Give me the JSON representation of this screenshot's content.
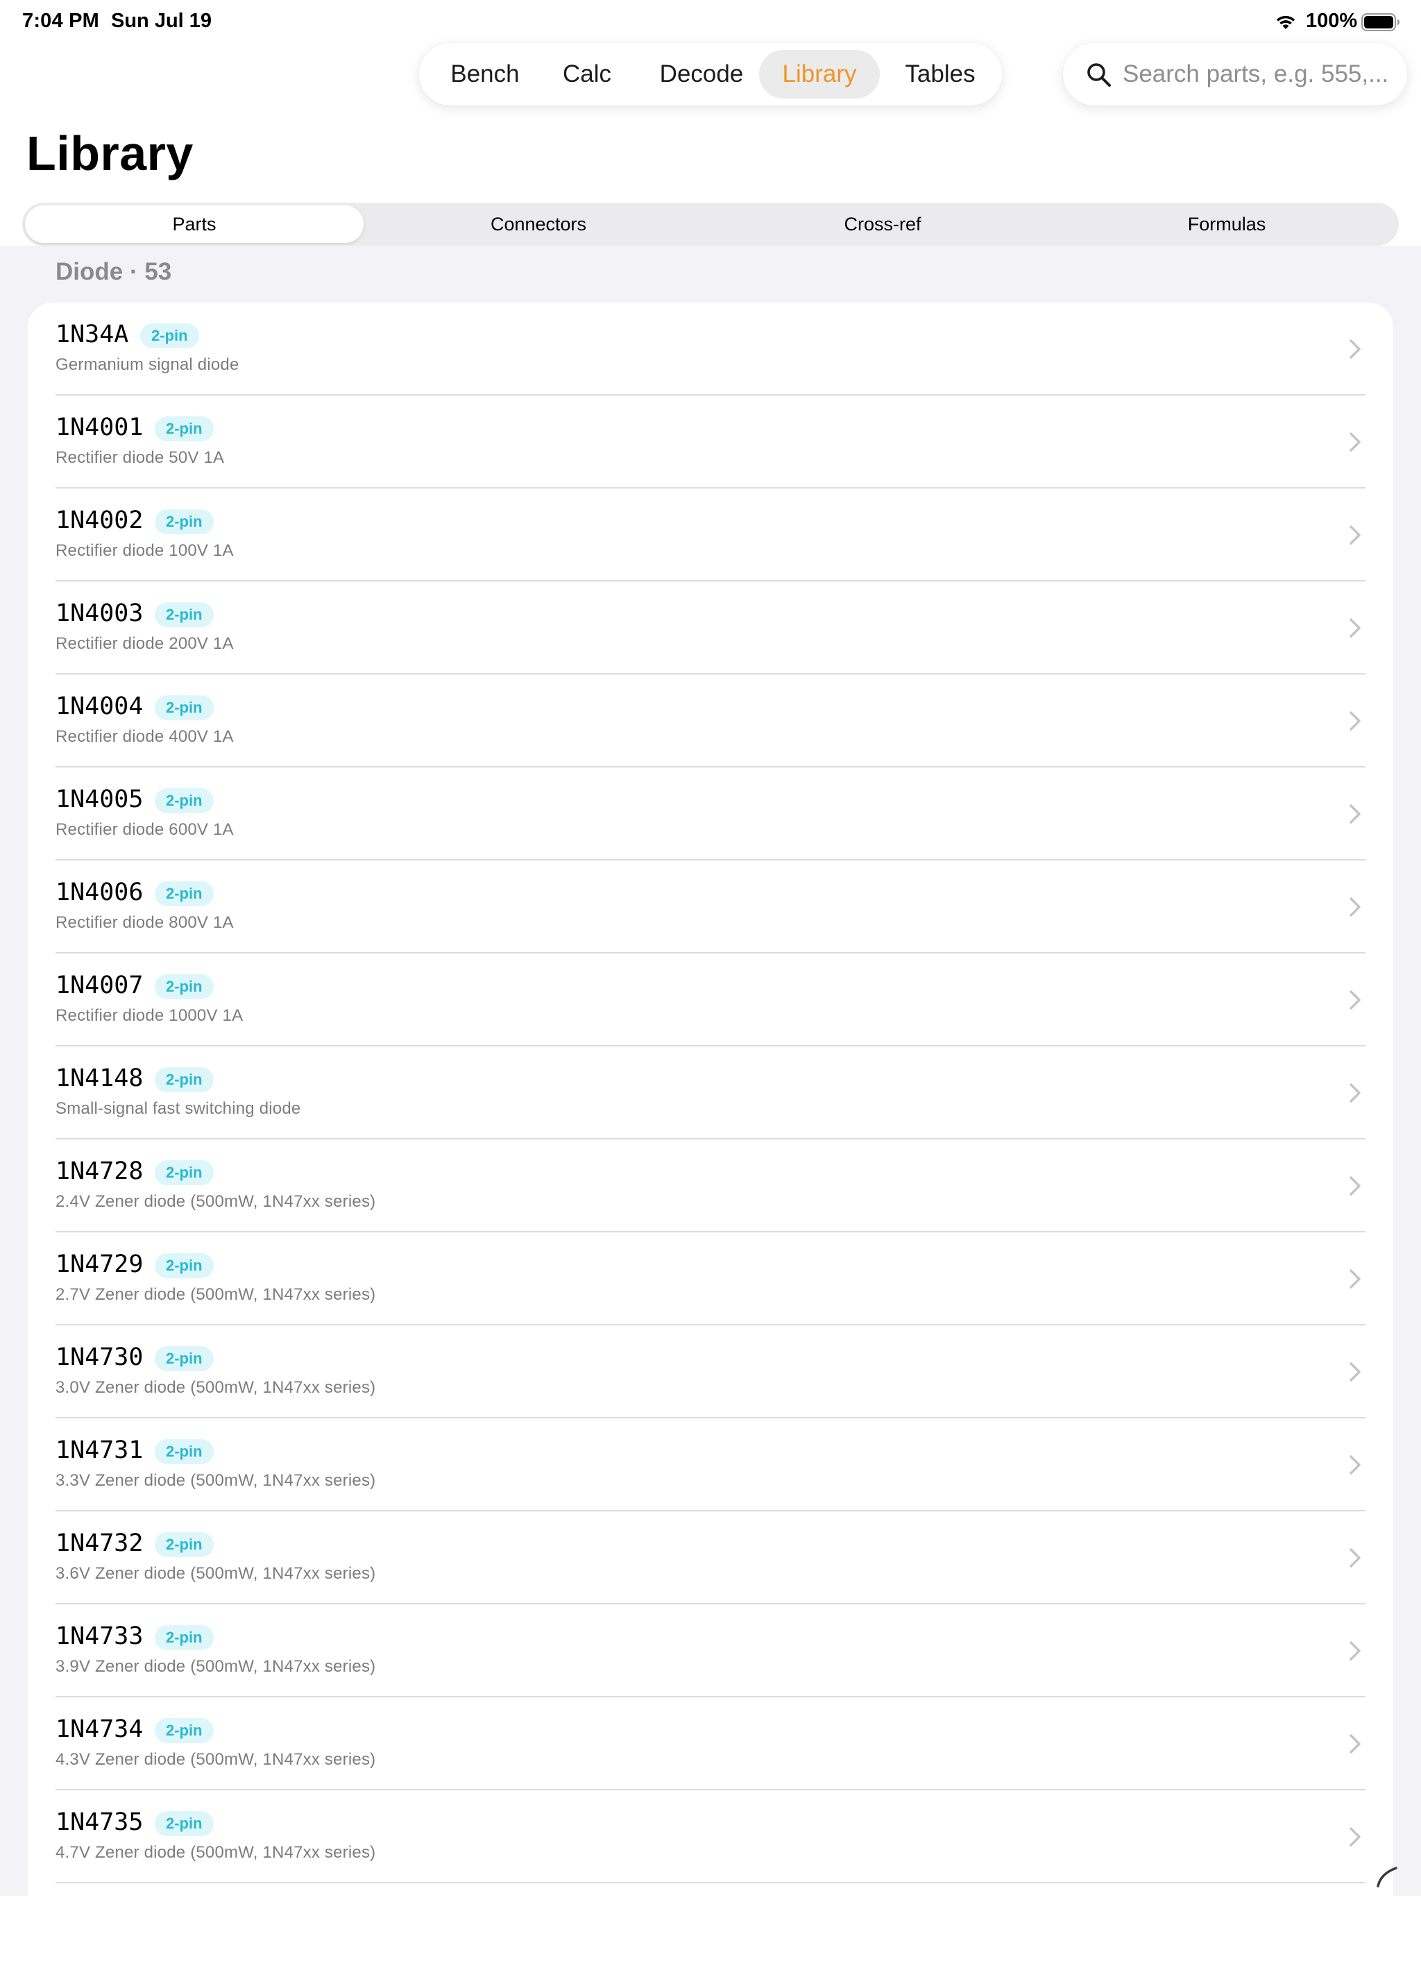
{
  "status_bar": {
    "time": "7:04 PM",
    "date": "Sun Jul 19",
    "battery": "100%"
  },
  "nav": {
    "tabs": [
      {
        "label": "Bench"
      },
      {
        "label": "Calc"
      },
      {
        "label": "Decode"
      },
      {
        "label": "Library"
      },
      {
        "label": "Tables"
      }
    ],
    "active": "Library",
    "accent_color": "#f0942a"
  },
  "search": {
    "placeholder": "Search parts, e.g. 555,...",
    "value": ""
  },
  "page": {
    "title": "Library"
  },
  "segments": {
    "items": [
      {
        "label": "Parts"
      },
      {
        "label": "Connectors"
      },
      {
        "label": "Cross-ref"
      },
      {
        "label": "Formulas"
      }
    ],
    "active": "Parts"
  },
  "section": {
    "header": "Diode · 53"
  },
  "parts": [
    {
      "name": "1N34A",
      "badge": "2-pin",
      "desc": "Germanium signal diode"
    },
    {
      "name": "1N4001",
      "badge": "2-pin",
      "desc": "Rectifier diode 50V 1A"
    },
    {
      "name": "1N4002",
      "badge": "2-pin",
      "desc": "Rectifier diode 100V 1A"
    },
    {
      "name": "1N4003",
      "badge": "2-pin",
      "desc": "Rectifier diode 200V 1A"
    },
    {
      "name": "1N4004",
      "badge": "2-pin",
      "desc": "Rectifier diode 400V 1A"
    },
    {
      "name": "1N4005",
      "badge": "2-pin",
      "desc": "Rectifier diode 600V 1A"
    },
    {
      "name": "1N4006",
      "badge": "2-pin",
      "desc": "Rectifier diode 800V 1A"
    },
    {
      "name": "1N4007",
      "badge": "2-pin",
      "desc": "Rectifier diode 1000V 1A"
    },
    {
      "name": "1N4148",
      "badge": "2-pin",
      "desc": "Small-signal fast switching diode"
    },
    {
      "name": "1N4728",
      "badge": "2-pin",
      "desc": "2.4V Zener diode (500mW, 1N47xx series)"
    },
    {
      "name": "1N4729",
      "badge": "2-pin",
      "desc": "2.7V Zener diode (500mW, 1N47xx series)"
    },
    {
      "name": "1N4730",
      "badge": "2-pin",
      "desc": "3.0V Zener diode (500mW, 1N47xx series)"
    },
    {
      "name": "1N4731",
      "badge": "2-pin",
      "desc": "3.3V Zener diode (500mW, 1N47xx series)"
    },
    {
      "name": "1N4732",
      "badge": "2-pin",
      "desc": "3.6V Zener diode (500mW, 1N47xx series)"
    },
    {
      "name": "1N4733",
      "badge": "2-pin",
      "desc": "3.9V Zener diode (500mW, 1N47xx series)"
    },
    {
      "name": "1N4734",
      "badge": "2-pin",
      "desc": "4.3V Zener diode (500mW, 1N47xx series)"
    },
    {
      "name": "1N4735",
      "badge": "2-pin",
      "desc": "4.7V Zener diode (500mW, 1N47xx series)"
    }
  ]
}
